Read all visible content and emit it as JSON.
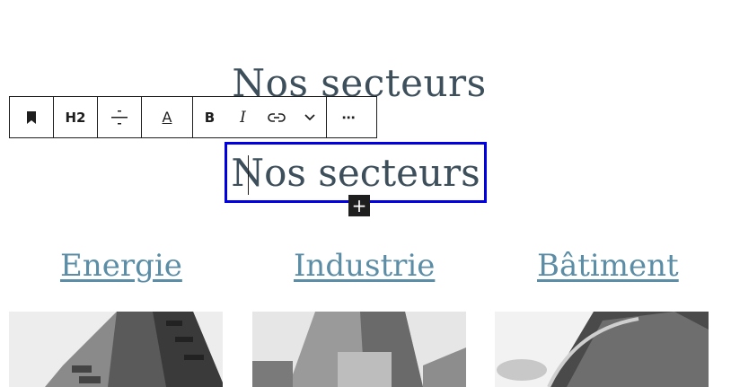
{
  "page": {
    "heading_top": "Nos secteurs",
    "heading_selected": "Nos secteurs"
  },
  "toolbar": {
    "bookmark_icon": "bookmark-icon",
    "heading_level": "H2",
    "align_icon": "align-center-icon",
    "text_color_label": "A",
    "bold_label": "B",
    "italic_label": "I",
    "link_icon": "link-icon",
    "more_rich_icon": "chevron-down-icon",
    "options_label": "⋯"
  },
  "add_block": {
    "label": "+"
  },
  "sectors": [
    {
      "label": "Energie"
    },
    {
      "label": "Industrie"
    },
    {
      "label": "Bâtiment"
    }
  ]
}
